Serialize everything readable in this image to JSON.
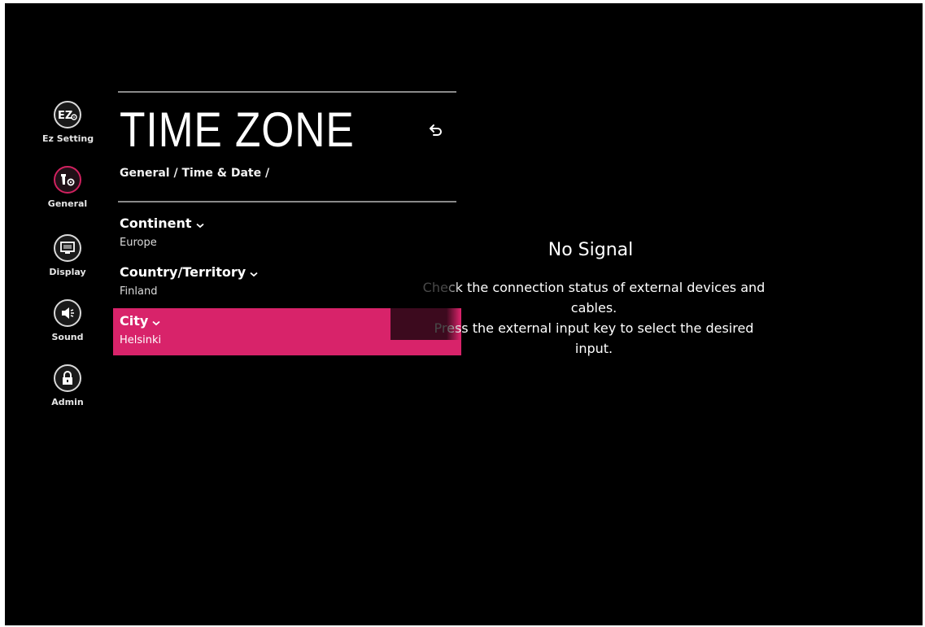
{
  "sidebar": {
    "items": [
      {
        "label": "Ez Setting",
        "icon": "ez-setting-icon"
      },
      {
        "label": "General",
        "icon": "general-settings-icon"
      },
      {
        "label": "Display",
        "icon": "display-icon"
      },
      {
        "label": "Sound",
        "icon": "speaker-icon"
      },
      {
        "label": "Admin",
        "icon": "lock-icon"
      }
    ],
    "active": "General"
  },
  "panel": {
    "title": "TIME ZONE",
    "breadcrumb": "General / Time & Date /"
  },
  "settings": [
    {
      "label": "Continent",
      "value": "Europe"
    },
    {
      "label": "Country/Territory",
      "value": "Finland"
    },
    {
      "label": "City",
      "value": "Helsinki"
    }
  ],
  "selected_setting": "City",
  "signal_message": {
    "title": "No Signal",
    "line1": "Check the connection status of external devices and",
    "line2": "cables.",
    "line3": "Press the external input key to select the desired",
    "line4": "input."
  },
  "colors": {
    "accent": "#d8236a",
    "background": "#000000"
  }
}
